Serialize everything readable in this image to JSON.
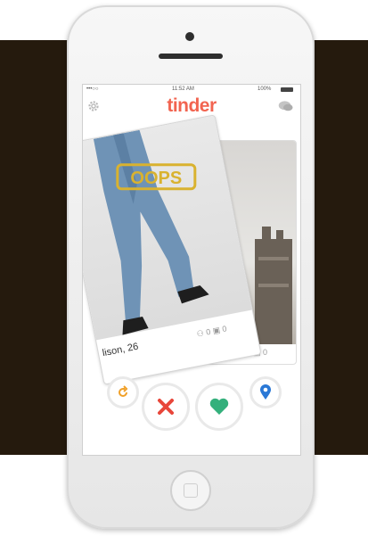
{
  "status_bar": {
    "carrier": "•••○○",
    "time": "11:52 AM",
    "battery": "100%"
  },
  "header": {
    "logo": "tinder",
    "left_icon": "gear-icon",
    "right_icon": "chat-bubbles-icon"
  },
  "stamp_text": "OOPS",
  "card": {
    "name": "lison, 26",
    "shared_interests": "0",
    "photos": "0",
    "back_count": "0"
  },
  "buttons": {
    "undo": "undo-icon",
    "nope": "x-icon",
    "like": "heart-icon",
    "info": "location-pin-icon"
  },
  "colors": {
    "background_band": "#251a0d",
    "logo": "#f26450",
    "stamp": "#d9b22f",
    "nope": "#e8463a",
    "like": "#34b07c",
    "info": "#2a78d6",
    "undo": "#f0a028"
  }
}
